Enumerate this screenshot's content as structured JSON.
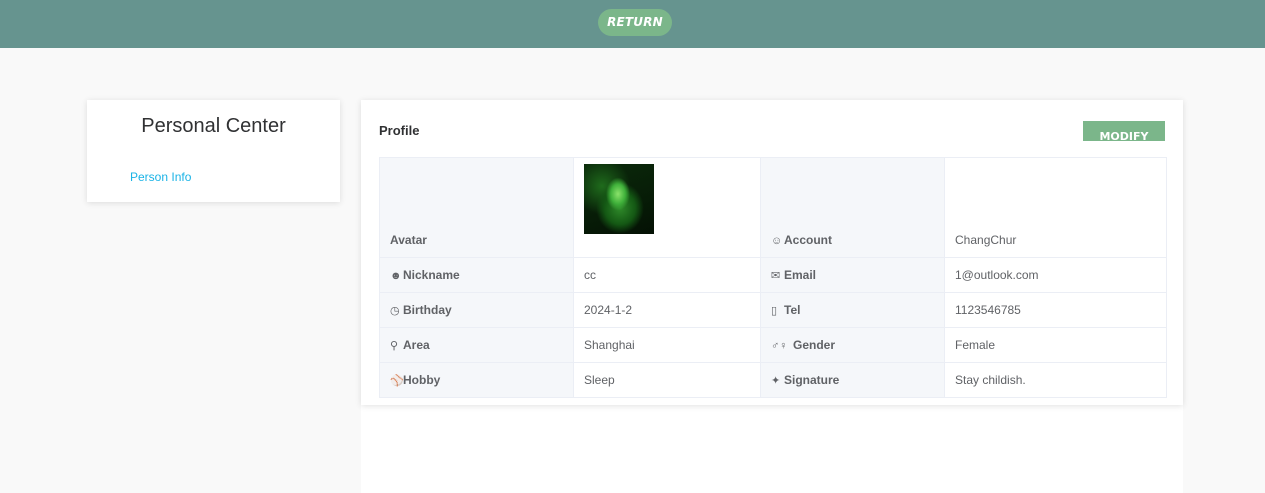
{
  "header": {
    "return_label": "RETURN"
  },
  "sidebar": {
    "title": "Personal Center",
    "items": [
      {
        "label": "Person Info"
      }
    ]
  },
  "profile": {
    "title": "Profile",
    "modify_label": "MODIFY",
    "rows": [
      {
        "left_label": "Avatar",
        "left_icon": "",
        "left_value": "",
        "right_label": "Account",
        "right_icon": "user-outline-icon",
        "right_value": "ChangChur"
      },
      {
        "left_label": "Nickname",
        "left_icon": "user-solid-icon",
        "left_value": "cc",
        "right_label": "Email",
        "right_icon": "envelope-icon",
        "right_value": "1@outlook.com"
      },
      {
        "left_label": "Birthday",
        "left_icon": "clock-icon",
        "left_value": "2024-1-2",
        "right_label": "Tel",
        "right_icon": "mobile-phone-icon",
        "right_value": "1123546785"
      },
      {
        "left_label": "Area",
        "left_icon": "location-person-icon",
        "left_value": "Shanghai",
        "right_label": "Gender",
        "right_icon": "male-female-icon",
        "right_value": "Female"
      },
      {
        "left_label": "Hobby",
        "left_icon": "basketball-icon",
        "left_value": "Sleep",
        "right_label": "Signature",
        "right_icon": "sparkle-icon",
        "right_value": "Stay childish."
      }
    ]
  },
  "colors": {
    "header_bg": "#66948f",
    "accent_green": "#7bb68a",
    "link_blue": "#1ab3e6"
  }
}
